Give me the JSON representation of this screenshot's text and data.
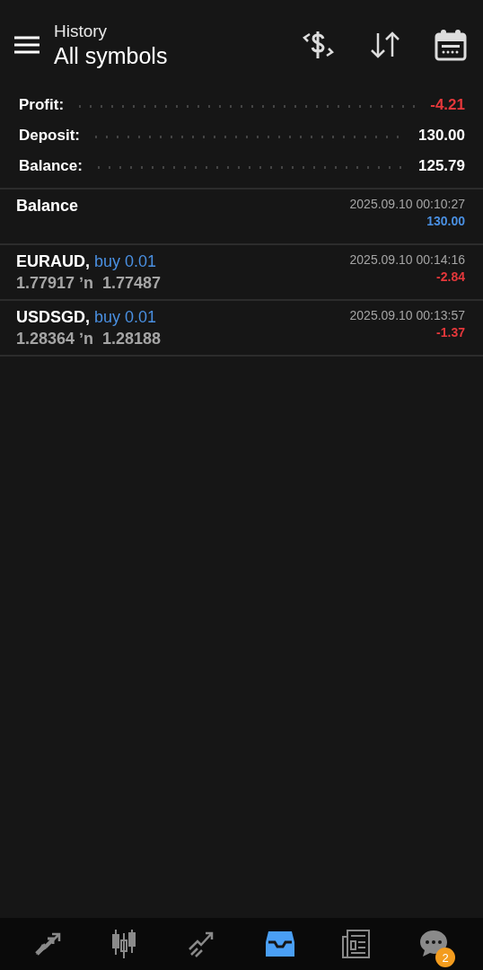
{
  "header": {
    "title": "History",
    "subtitle": "All symbols"
  },
  "summary": [
    {
      "label": "Profit:",
      "value": "-4.21",
      "color": "#e5383b"
    },
    {
      "label": "Deposit:",
      "value": "130.00",
      "color": "#ffffff"
    },
    {
      "label": "Balance:",
      "value": "125.79",
      "color": "#ffffff"
    }
  ],
  "deals": [
    {
      "kind": "balance",
      "name": "Balance",
      "time": "2025.09.10 00:10:27",
      "amount": "130.00",
      "color": "#4a90e2"
    },
    {
      "kind": "trade",
      "name": "EURAUD,",
      "side": "buy 0.01",
      "prices": "1.77917 ʼn  1.77487",
      "time": "2025.09.10 00:14:16",
      "amount": "-2.84",
      "color": "#e5383b"
    },
    {
      "kind": "trade",
      "name": "USDSGD,",
      "side": "buy 0.01",
      "prices": "1.28364 ʼn  1.28188",
      "time": "2025.09.10 00:13:57",
      "amount": "-1.37",
      "color": "#e5383b"
    }
  ],
  "nav": [
    {
      "kind": "trade",
      "selected": false
    },
    {
      "kind": "chart",
      "selected": false
    },
    {
      "kind": "trend",
      "selected": false
    },
    {
      "kind": "history",
      "selected": true
    },
    {
      "kind": "news",
      "selected": false
    },
    {
      "kind": "chat",
      "selected": false,
      "badge": "2"
    }
  ]
}
